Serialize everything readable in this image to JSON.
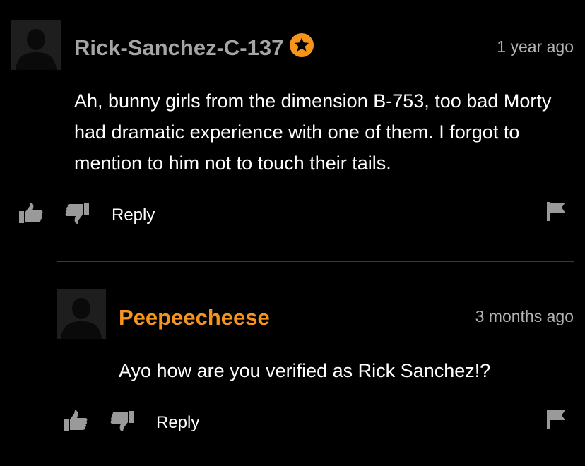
{
  "comments": [
    {
      "username": "Rick-Sanchez-C-137",
      "verified": true,
      "timestamp": "1 year ago",
      "body": "Ah, bunny girls from the dimension B-753, too bad Morty had dramatic experience with one of them. I forgot to mention to him not to touch their tails.",
      "reply_label": "Reply",
      "avatar_icon": "default-user-silhouette-icon",
      "badge_icon": "star-icon"
    },
    {
      "username": "Peepeecheese",
      "verified": false,
      "timestamp": "3 months ago",
      "body": "Ayo how are you verified as Rick Sanchez!?",
      "reply_label": "Reply",
      "avatar_icon": "default-user-silhouette-icon"
    }
  ],
  "icons": {
    "like": "thumbs-up-icon",
    "dislike": "thumbs-down-icon",
    "report": "flag-icon"
  },
  "colors": {
    "background": "#000000",
    "verified_username": "#a5a5a5",
    "username": "#f7941d",
    "badge": "#f7941d",
    "text": "#ffffff",
    "timestamp": "#b3b3b3",
    "divider": "#3a3a3a",
    "icon": "#9a9a9a"
  }
}
